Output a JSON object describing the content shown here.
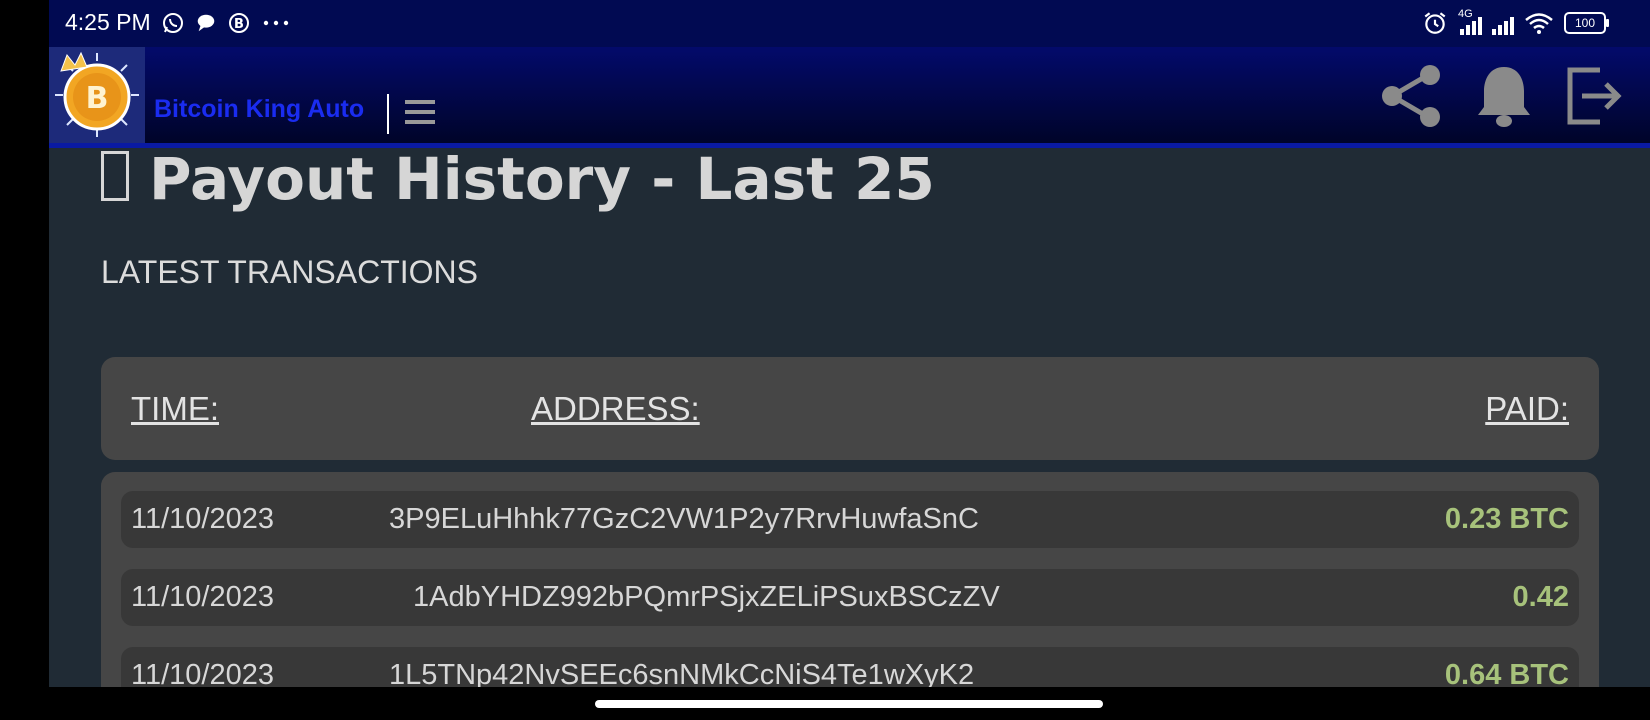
{
  "status_bar": {
    "time": "4:25 PM",
    "network_label": "4G",
    "battery": "100",
    "icons_left": [
      "whatsapp-icon",
      "chat-bubble-icon",
      "b-app-icon",
      "more-dots-icon"
    ],
    "icons_right": [
      "alarm-icon",
      "signal-4g-icon",
      "signal-icon",
      "wifi-icon",
      "battery-icon"
    ]
  },
  "app_bar": {
    "brand": "Bitcoin King Auto",
    "icons": [
      "bitcoin-king-logo-icon",
      "menu-icon",
      "share-icon",
      "bell-icon",
      "logout-icon"
    ]
  },
  "page": {
    "title": "Payout History - Last 25",
    "section_label": "LATEST TRANSACTIONS"
  },
  "table": {
    "headers": {
      "time": "TIME:",
      "address": "ADDRESS:",
      "paid": "PAID:"
    },
    "rows": [
      {
        "time": "11/10/2023",
        "address": "3P9ELuHhhk77GzC2VW1P2y7RrvHuwfaSnC",
        "paid": "0.23 BTC"
      },
      {
        "time": "11/10/2023",
        "address": "1AdbYHDZ992bPQmrPSjxZELiPSuxBSCzZV",
        "paid": "0.42"
      },
      {
        "time": "11/10/2023",
        "address": "1L5TNp42NvSEEc6snNMkCcNiS4Te1wXyK2",
        "paid": "0.64 BTC"
      }
    ]
  },
  "colors": {
    "status_bar": "#010a52",
    "app_bar": "#030a6b",
    "brand_text": "#1a2cf0",
    "background": "#202b35",
    "card": "#464646",
    "row": "#383838",
    "paid_text": "#a7c27b"
  }
}
